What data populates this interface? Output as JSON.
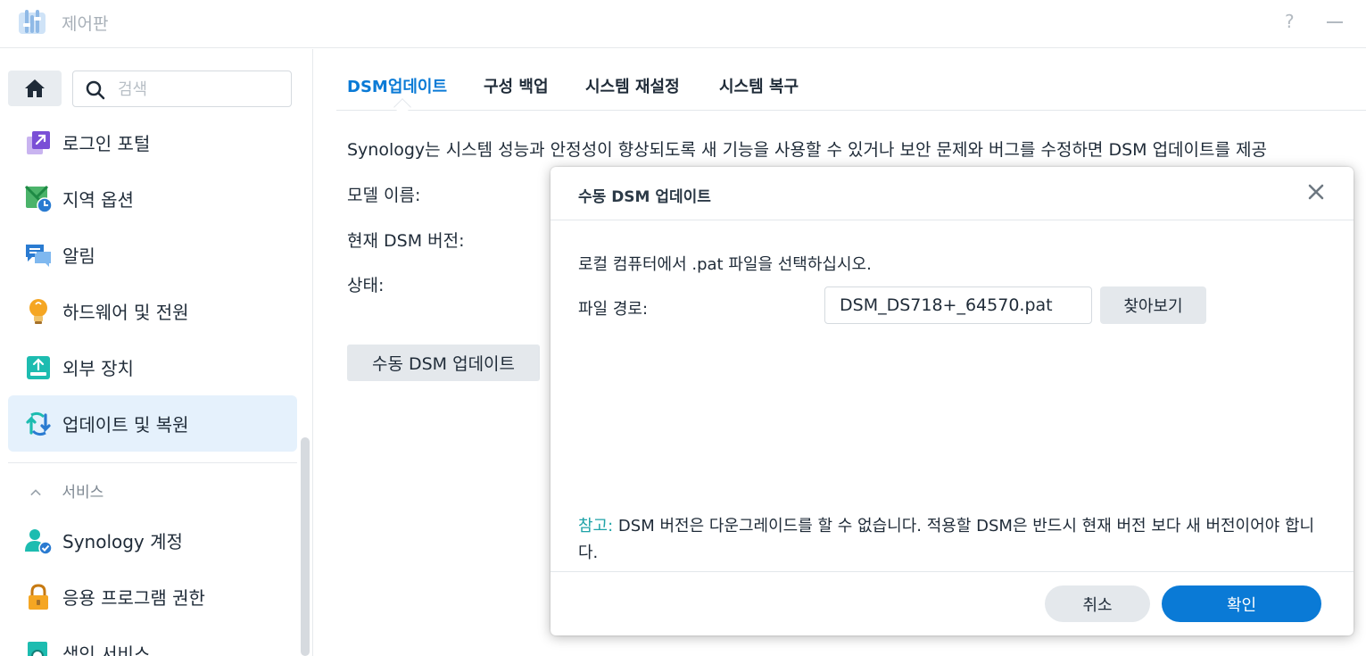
{
  "window": {
    "title": "제어판",
    "help_symbol": "?"
  },
  "sidebar": {
    "search_placeholder": "검색",
    "items": [
      {
        "label": "로그인 포털",
        "icon": "login-portal-icon"
      },
      {
        "label": "지역 옵션",
        "icon": "regional-options-icon"
      },
      {
        "label": "알림",
        "icon": "notification-icon"
      },
      {
        "label": "하드웨어 및 전원",
        "icon": "hardware-power-icon"
      },
      {
        "label": "외부 장치",
        "icon": "external-devices-icon"
      },
      {
        "label": "업데이트 및 복원",
        "icon": "update-restore-icon",
        "active": true
      }
    ],
    "services_header": "서비스",
    "service_items": [
      {
        "label": "Synology 계정",
        "icon": "synology-account-icon"
      },
      {
        "label": "응용 프로그램 권한",
        "icon": "app-privileges-icon"
      },
      {
        "label": "색인 서비스",
        "icon": "indexing-service-icon"
      }
    ]
  },
  "main": {
    "tabs": [
      {
        "label": "DSM업데이트",
        "active": true
      },
      {
        "label": "구성 백업"
      },
      {
        "label": "시스템 재설정"
      },
      {
        "label": "시스템 복구"
      }
    ],
    "description": "Synology는 시스템 성능과 안정성이 향상되도록 새 기능을 사용할 수 있거나 보안 문제와 버그를 수정하면 DSM 업데이트를 제공",
    "labels": {
      "model_name": "모델 이름:",
      "current_version": "현재 DSM 버전:",
      "status": "상태:"
    },
    "manual_update_button": "수동 DSM 업데이트"
  },
  "dialog": {
    "title": "수동 DSM 업데이트",
    "instruction": "로컬 컴퓨터에서 .pat 파일을 선택하십시오.",
    "file_path_label": "파일 경로:",
    "file_path_value": "DSM_DS718+_64570.pat",
    "browse_button": "찾아보기",
    "note_prefix": "참고:",
    "note_text": " DSM 버전은 다운그레이드를 할 수 없습니다. 적용할 DSM은 반드시 현재 버전 보다 새 버전이어야 합니다.",
    "cancel_button": "취소",
    "ok_button": "확인"
  },
  "colors": {
    "accent": "#0a7ad6",
    "note_accent": "#20a3a8",
    "active_nav_bg": "#e5f1fc"
  }
}
